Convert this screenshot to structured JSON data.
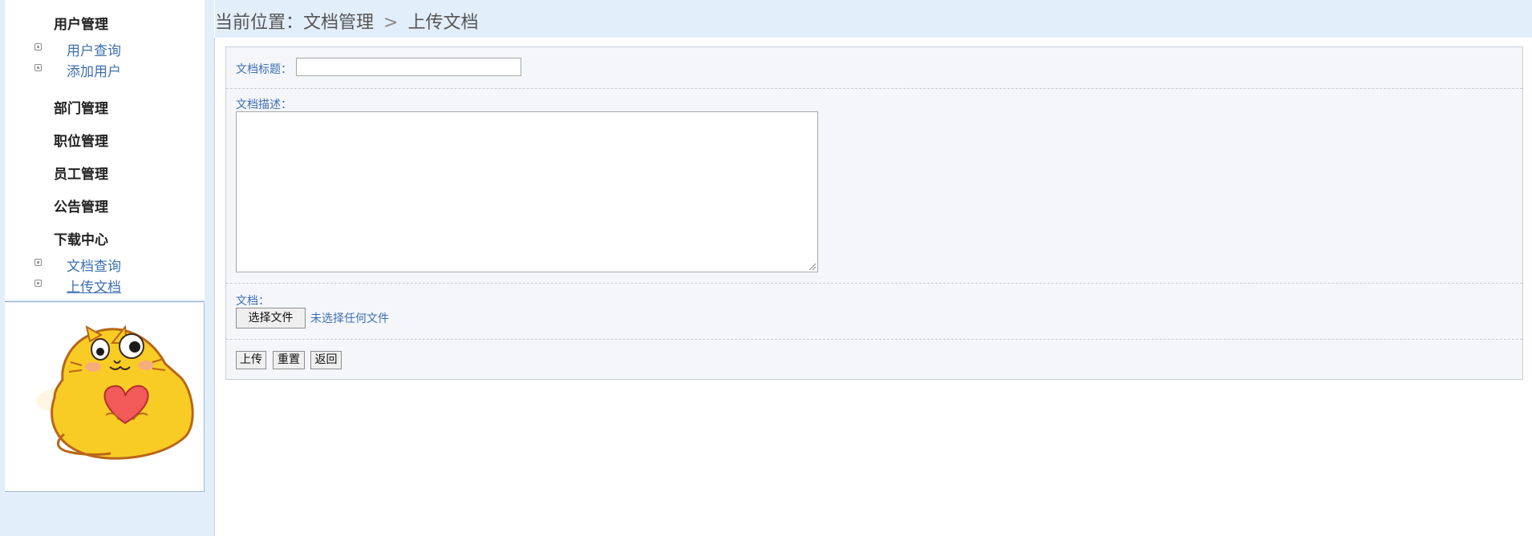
{
  "breadcrumb": {
    "prefix": "当前位置：",
    "section": "文档管理",
    "separator": ">",
    "current": "上传文档"
  },
  "sidebar": {
    "groups": [
      {
        "title": "用户管理",
        "items": [
          "用户查询",
          "添加用户"
        ]
      },
      {
        "title": "部门管理"
      },
      {
        "title": "职位管理"
      },
      {
        "title": "员工管理"
      },
      {
        "title": "公告管理"
      },
      {
        "title": "下载中心",
        "items": [
          "文档查询",
          "上传文档"
        ]
      }
    ],
    "active_item": "上传文档"
  },
  "form": {
    "title_label": "文档标题：",
    "title_value": "",
    "description_label": "文档描述：",
    "description_value": "",
    "file_label": "文档：",
    "file_button_label": "选择文件",
    "file_status": "未选择任何文件",
    "upload_button_label": "上传",
    "reset_button_label": "重置",
    "back_button_label": "返回"
  },
  "colors": {
    "background_panel": "#e3eefb",
    "link": "#3e6fb0",
    "form_background": "#f4f6fa"
  }
}
